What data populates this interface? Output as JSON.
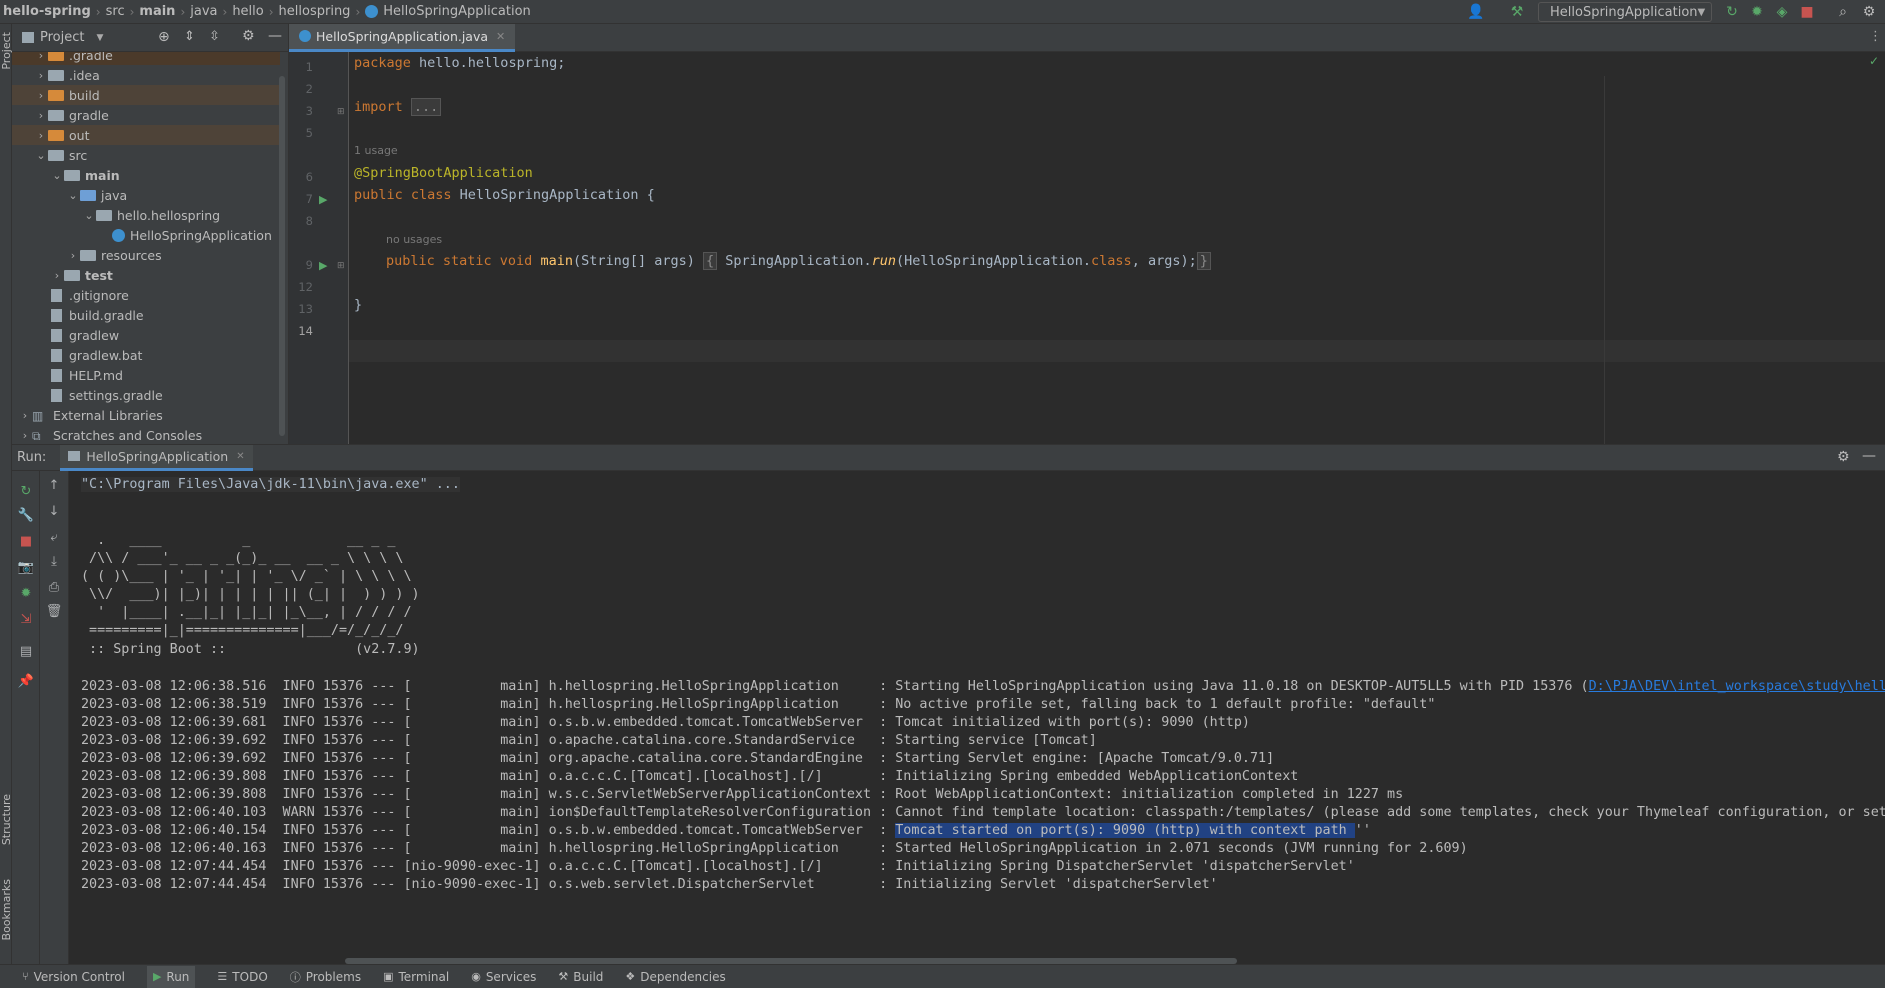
{
  "breadcrumb": [
    "hello-spring",
    "src",
    "main",
    "java",
    "hello",
    "hellospring",
    "HelloSpringApplication"
  ],
  "toolbar": {
    "run_config": "HelloSpringApplication"
  },
  "left_stripe": {
    "project": "Project",
    "structure": "Structure",
    "bookmarks": "Bookmarks"
  },
  "project_panel": {
    "title": "Project",
    "tree": [
      {
        "label": ".gradle",
        "depth": 1,
        "kind": "folder-orange",
        "expanded": false,
        "hl": "hl"
      },
      {
        "label": ".idea",
        "depth": 1,
        "kind": "folder",
        "expanded": false
      },
      {
        "label": "build",
        "depth": 1,
        "kind": "folder-orange",
        "expanded": false,
        "hl": "hl2"
      },
      {
        "label": "gradle",
        "depth": 1,
        "kind": "folder",
        "expanded": false
      },
      {
        "label": "out",
        "depth": 1,
        "kind": "folder-orange",
        "expanded": false,
        "hl": "hl2"
      },
      {
        "label": "src",
        "depth": 1,
        "kind": "folder",
        "expanded": true
      },
      {
        "label": "main",
        "depth": 2,
        "kind": "folder",
        "expanded": true,
        "bold": true
      },
      {
        "label": "java",
        "depth": 3,
        "kind": "folder-blue",
        "expanded": true
      },
      {
        "label": "hello.hellospring",
        "depth": 4,
        "kind": "folder",
        "expanded": true
      },
      {
        "label": "HelloSpringApplication",
        "depth": 5,
        "kind": "class"
      },
      {
        "label": "resources",
        "depth": 3,
        "kind": "folder",
        "expanded": false
      },
      {
        "label": "test",
        "depth": 2,
        "kind": "folder",
        "expanded": false,
        "bold": true
      },
      {
        "label": ".gitignore",
        "depth": 1,
        "kind": "file"
      },
      {
        "label": "build.gradle",
        "depth": 1,
        "kind": "file"
      },
      {
        "label": "gradlew",
        "depth": 1,
        "kind": "file"
      },
      {
        "label": "gradlew.bat",
        "depth": 1,
        "kind": "file"
      },
      {
        "label": "HELP.md",
        "depth": 1,
        "kind": "file"
      },
      {
        "label": "settings.gradle",
        "depth": 1,
        "kind": "file"
      },
      {
        "label": "External Libraries",
        "depth": 0,
        "kind": "lib",
        "expanded": false
      },
      {
        "label": "Scratches and Consoles",
        "depth": 0,
        "kind": "scratch",
        "expanded": false
      }
    ]
  },
  "editor": {
    "tab": "HelloSpringApplication.java",
    "line_numbers": [
      "1",
      "2",
      "3",
      "5",
      "",
      "6",
      "7",
      "8",
      "",
      "9",
      "12",
      "13",
      "14"
    ],
    "hint_usage": "1 usage",
    "hint_no_usages": "no usages",
    "code": {
      "l1_kw": "package",
      "l1_rest": " hello.hellospring;",
      "l3_kw": "import",
      "l3_fold": "...",
      "l6": "@SpringBootApplication",
      "l7_kw": "public class",
      "l7_rest": " HelloSpringApplication {",
      "l9_kw": "public static void",
      "l9_fn": " main",
      "l9_a": "(String[] args) ",
      "l9_fold_open": "{",
      "l9_b": " SpringApplication.",
      "l9_run": "run",
      "l9_c": "(HelloSpringApplication.",
      "l9_cls": "class",
      "l9_d": ", args);",
      "l9_fold_close": "}",
      "l13": "}"
    }
  },
  "run_panel": {
    "label": "Run:",
    "tab": "HelloSpringApplication",
    "cmd": "\"C:\\Program Files\\Java\\jdk-11\\bin\\java.exe\" ...",
    "banner": [
      "  .   ____          _            __ _ _",
      " /\\\\ / ___'_ __ _ _(_)_ __  __ _ \\ \\ \\ \\",
      "( ( )\\___ | '_ | '_| | '_ \\/ _` | \\ \\ \\ \\",
      " \\\\/  ___)| |_)| | | | | || (_| |  ) ) ) )",
      "  '  |____| .__|_| |_|_| |_\\__, | / / / /",
      " =========|_|==============|___/=/_/_/_/",
      " :: Spring Boot ::                (v2.7.9)"
    ],
    "log": [
      "2023-03-08 12:06:38.516  INFO 15376 --- [           main] h.hellospring.HelloSpringApplication     : Starting HelloSpringApplication using Java 11.0.18 on DESKTOP-AUT5LL5 with PID 15376 (",
      "2023-03-08 12:06:38.519  INFO 15376 --- [           main] h.hellospring.HelloSpringApplication     : No active profile set, falling back to 1 default profile: \"default\"",
      "2023-03-08 12:06:39.681  INFO 15376 --- [           main] o.s.b.w.embedded.tomcat.TomcatWebServer  : Tomcat initialized with port(s): 9090 (http)",
      "2023-03-08 12:06:39.692  INFO 15376 --- [           main] o.apache.catalina.core.StandardService   : Starting service [Tomcat]",
      "2023-03-08 12:06:39.692  INFO 15376 --- [           main] org.apache.catalina.core.StandardEngine  : Starting Servlet engine: [Apache Tomcat/9.0.71]",
      "2023-03-08 12:06:39.808  INFO 15376 --- [           main] o.a.c.c.C.[Tomcat].[localhost].[/]       : Initializing Spring embedded WebApplicationContext",
      "2023-03-08 12:06:39.808  INFO 15376 --- [           main] w.s.c.ServletWebServerApplicationContext : Root WebApplicationContext: initialization completed in 1227 ms",
      "2023-03-08 12:06:40.103  WARN 15376 --- [           main] ion$DefaultTemplateResolverConfiguration : Cannot find template location: classpath:/templates/ (please add some templates, check your Thymeleaf configuration, or set s",
      "2023-03-08 12:06:40.154  INFO 15376 --- [           main] o.s.b.w.embedded.tomcat.TomcatWebServer  : ",
      "2023-03-08 12:06:40.163  INFO 15376 --- [           main] h.hellospring.HelloSpringApplication     : Started HelloSpringApplication in 2.071 seconds (JVM running for 2.609)",
      "2023-03-08 12:07:44.454  INFO 15376 --- [nio-9090-exec-1] o.a.c.c.C.[Tomcat].[localhost].[/]       : Initializing Spring DispatcherServlet 'dispatcherServlet'",
      "2023-03-08 12:07:44.454  INFO 15376 --- [nio-9090-exec-1] o.s.web.servlet.DispatcherServlet        : Initializing Servlet 'dispatcherServlet'"
    ],
    "log_link": "D:\\PJA\\DEV\\intel_workspace\\study\\hello",
    "log_selected": "Tomcat started on port(s): 9090 (http) with context path ",
    "log_selected_tail": "''"
  },
  "statusbar": {
    "items": [
      "Version Control",
      "Run",
      "TODO",
      "Problems",
      "Terminal",
      "Services",
      "Build",
      "Dependencies"
    ]
  },
  "colors": {
    "accent": "#4a88c7",
    "keyword": "#cc7832",
    "annotation": "#bbb529",
    "function": "#ffc66d",
    "link": "#287bde",
    "selection": "#214283"
  }
}
